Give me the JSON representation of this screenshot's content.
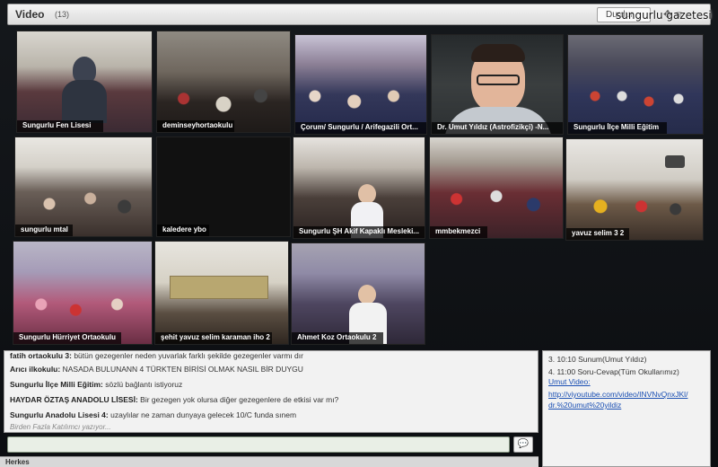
{
  "window": {
    "title": "Video",
    "participant_count": "(13)",
    "button_label": "Durdur",
    "watermark": "sungurlu gazetesi"
  },
  "video_tiles": [
    {
      "label": "Sungurlu Fen Lisesi"
    },
    {
      "label": "deminseyhortaokulu"
    },
    {
      "label": "Çorum/ Sungurlu / Arifegazili Ort..."
    },
    {
      "label": "Dr. Umut Yıldız (Astrofizikçi) -N..."
    },
    {
      "label": "Sungurlu İlçe Milli Eğitim"
    },
    {
      "label": "sungurlu mtal"
    },
    {
      "label": "kaledere ybo"
    },
    {
      "label": "Sungurlu ŞH Akif Kapaklı Mesleki..."
    },
    {
      "label": "mmbekmezci"
    },
    {
      "label": "yavuz selim 3 2"
    },
    {
      "label": "Sungurlu Hürriyet Ortaokulu"
    },
    {
      "label": "şehit yavuz selim karaman iho 2"
    },
    {
      "label": "Ahmet Koz Ortaokulu 2"
    }
  ],
  "chat": {
    "messages": [
      {
        "sender": "fatih ortaokulu 3:",
        "text": "bütün gezegenler neden yuvarlak farklı şekilde gezegenler varmı dır"
      },
      {
        "sender": "Arıcı ilkokulu:",
        "text": "NASADA BULUNANN 4 TÜRKTEN BİRİSİ OLMAK NASIL BİR DUYGU"
      },
      {
        "sender": "Sungurlu İlçe Milli Eğitim:",
        "text": "sözlü bağlantı istiyoruz"
      },
      {
        "sender": "HAYDAR ÖZTAŞ ANADOLU LİSESİ:",
        "text": "Bir gezegen yok olursa diğer gezegenlere de etkisi var mı?"
      },
      {
        "sender": "Sungurlu Anadolu Lisesi 4:",
        "text": "uzaylılar ne zaman dunyaya gelecek 10/C funda sınem"
      }
    ],
    "typing_status": "Birden Fazla Katılımcı yazıyor...",
    "input_value": "",
    "send_icon": "speech-bubble-icon",
    "footer_label": "Herkes"
  },
  "agenda": {
    "items": [
      "3. 10:10 Sunum(Umut Yıldız)",
      "4. 11:00 Soru-Cevap(Tüm Okullarımız)"
    ],
    "video_label": "Umut Video:",
    "video_link_line1": "http://viyoutube.com/video/INVNvQnxJKl/",
    "video_link_line2": "dr.%20umut%20yildiz"
  }
}
